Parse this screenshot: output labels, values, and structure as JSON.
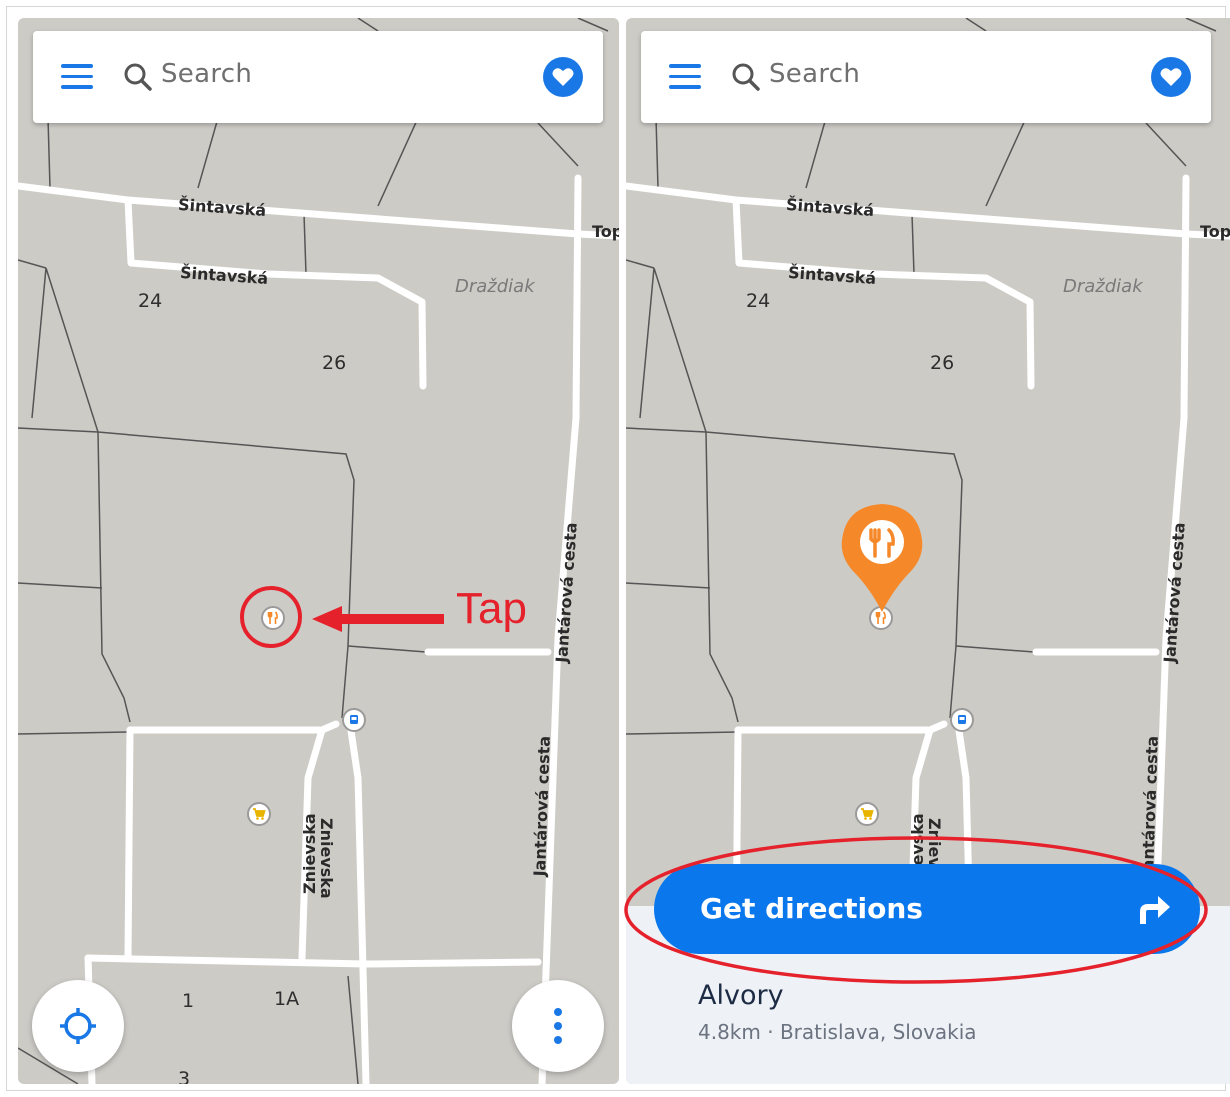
{
  "colors": {
    "map_bg": "#cdcbc6",
    "road": "#ffffff",
    "accent_blue": "#1a78e6",
    "button_blue": "#0a78ec",
    "annotation_red": "#e5212b",
    "pin_orange": "#f5892a"
  },
  "search": {
    "label": "Search"
  },
  "icons": {
    "menu": "hamburger-menu-icon",
    "search": "search-icon",
    "favorite": "heart-icon",
    "locate": "crosshair-locate-icon",
    "more": "more-vertical-icon",
    "restaurant": "fork-knife-icon",
    "shop": "shopping-cart-icon",
    "transit": "tram-icon",
    "directions": "turn-right-arrow-icon"
  },
  "map": {
    "streets": {
      "sintavska": "Šintavská",
      "top": "Top",
      "jantarova": "Jantárová cesta",
      "znievska": "Znievska"
    },
    "areas": {
      "drazdiak": "Draždiak"
    },
    "house_numbers": {
      "n24": "24",
      "n26": "26",
      "n1": "1",
      "n1a": "1A",
      "n3": "3"
    }
  },
  "annotation": {
    "tap": "Tap"
  },
  "place": {
    "directions_label": "Get directions",
    "name": "Alvory",
    "distance": "4.8km",
    "separator": "·",
    "location": "Bratislava, Slovakia"
  }
}
